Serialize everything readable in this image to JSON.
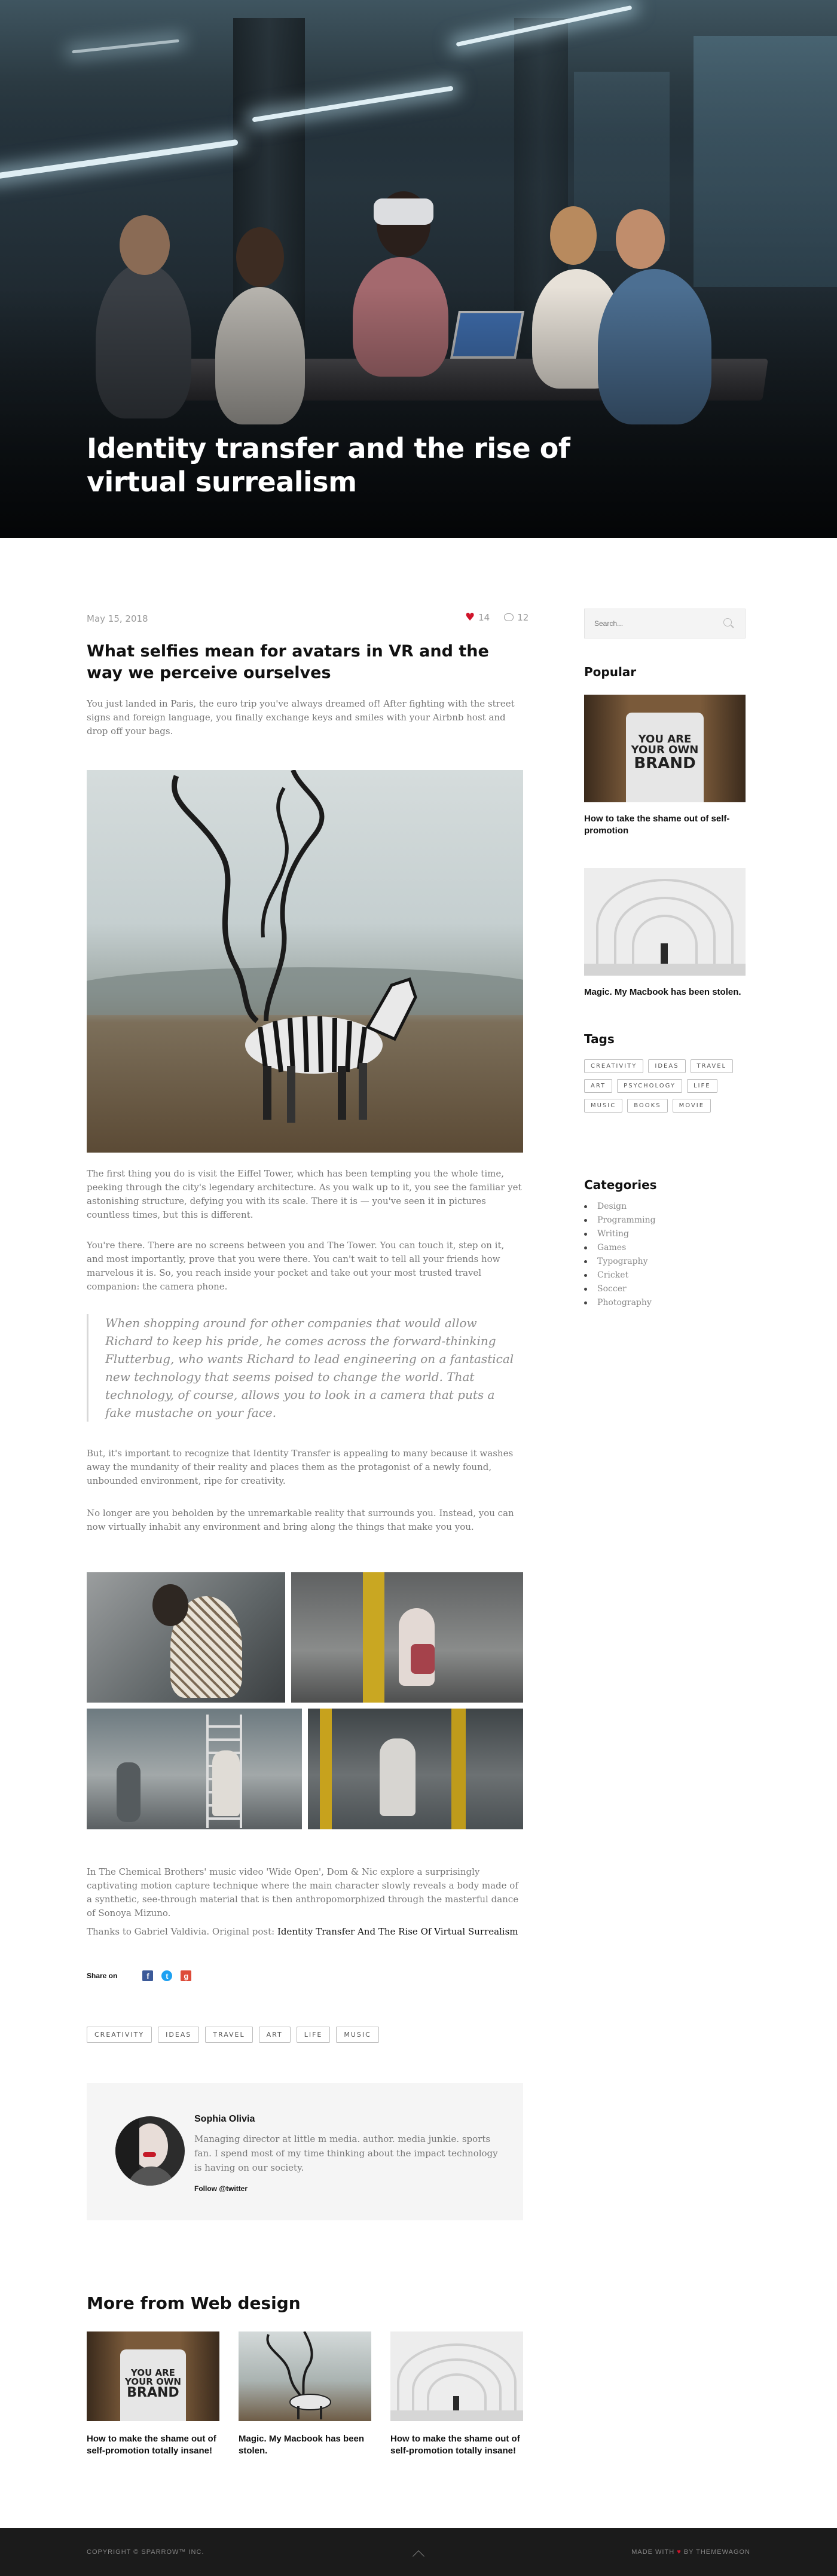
{
  "hero": {
    "title": "Identity transfer and the rise of virtual surrealism"
  },
  "post": {
    "date": "May 15, 2018",
    "likes": "14",
    "comments": "12",
    "subtitle": "What selfies mean for avatars in VR and the way we perceive ourselves",
    "intro": "You just landed in Paris, the euro trip you've always dreamed of! After fighting with the street signs and foreign language, you finally exchange keys and smiles with your Airbnb host and drop off your bags.",
    "p1": "The first thing you do is visit the Eiffel Tower, which has been tempting you the whole time, peeking through the city's legendary architecture. As you walk up to it, you see the familiar yet astonishing structure, defying you with its scale. There it is — you've seen it in pictures countless times, but this is different.",
    "p2": "You're there. There are no screens between you and The Tower. You can touch it, step on it, and most importantly, prove that you were there. You can't wait to tell all your friends how marvelous it is. So, you reach inside your pocket and take out your most trusted travel companion: the camera phone.",
    "quote": "When shopping around for other companies that would allow Richard to keep his pride, he comes across the forward-thinking Flutterbug, who wants Richard to lead engineering on a fantastical new technology that seems poised to change the world. That technology, of course, allows you to look in a camera that puts a fake mustache on your face.",
    "p3": "But, it's important to recognize that Identity Transfer is appealing to many because it washes away the mundanity of their reality and places them as the protagonist of a newly found, unbounded environment, ripe for creativity.",
    "p4": "No longer are you beholden by the unremarkable reality that surrounds you. Instead, you can now virtually inhabit any environment and bring along the things that make you you.",
    "p5": "In The Chemical Brothers' music video 'Wide Open', Dom & Nic explore a surprisingly captivating motion capture technique where the main character slowly reveals a body made of a synthetic, see-through material that is then anthropomorphized through the masterful dance of Sonoya Mizuno.",
    "credit_prefix": "Thanks to Gabriel Valdivia. Original post: ",
    "credit_link": "Identity Transfer And The Rise Of Virtual Surrealism",
    "share_label": "Share on",
    "tags": [
      "CREATIVITY",
      "IDEAS",
      "TRAVEL",
      "ART",
      "LIFE",
      "MUSIC"
    ]
  },
  "author": {
    "name": "Sophia Olivia",
    "bio": "Managing director at little m media. author. media junkie. sports fan. I spend most of my time thinking about the impact technology is having on our society.",
    "follow": "Follow @twitter"
  },
  "more": {
    "title": "More from Web design",
    "cards": [
      {
        "title": "How to make the shame out of self-promotion totally insane!"
      },
      {
        "title": "Magic. My Macbook has been stolen."
      },
      {
        "title": "How to make the shame out of self-promotion totally insane!"
      }
    ]
  },
  "sidebar": {
    "search_placeholder": "Search...",
    "popular_title": "Popular",
    "popular": [
      {
        "title": "How to take the shame out of self-promotion"
      },
      {
        "title": "Magic. My Macbook has been stolen."
      }
    ],
    "tags_title": "Tags",
    "tags": [
      "CREATIVITY",
      "IDEAS",
      "TRAVEL",
      "ART",
      "PSYCHOLOGY",
      "LIFE",
      "MUSIC",
      "BOOKS",
      "MOVIE"
    ],
    "categories_title": "Categories",
    "categories": [
      "Design",
      "Programming",
      "Writing",
      "Games",
      "Typography",
      "Cricket",
      "Soccer",
      "Photography"
    ]
  },
  "shirt_text": [
    "YOU ARE",
    "YOUR OWN",
    "BRAND"
  ],
  "footer": {
    "copyright": "COPYRIGHT © SPARROW™ INC.",
    "made_prefix": "MADE WITH ",
    "made_heart": "♥",
    "made_suffix": " BY THEMEWAGON"
  },
  "colors": {
    "accent": "#d0142a",
    "facebook": "#3b5998",
    "twitter": "#1da1f2",
    "google": "#dd4b39"
  }
}
